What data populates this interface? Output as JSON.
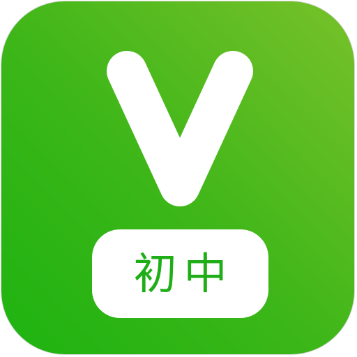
{
  "app_icon": {
    "logo_icon": "letter-v-logo",
    "label": "初中",
    "colors": {
      "gradient_start": "#1db311",
      "gradient_end": "#78c12a",
      "mark": "#ffffff",
      "label_text": "#1fae17"
    }
  }
}
